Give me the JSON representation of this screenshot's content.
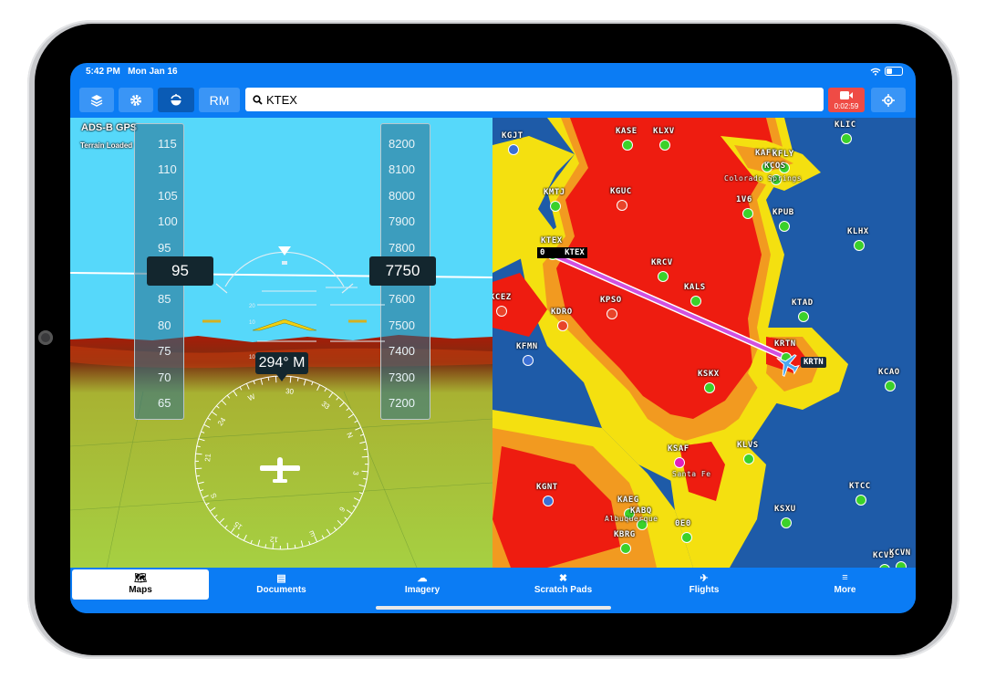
{
  "status_bar": {
    "time": "5:42 PM",
    "date": "Mon Jan 16",
    "wifi_icon": "wifi-icon",
    "battery_level": 0.35
  },
  "toolbar": {
    "layers_icon": "layers-icon",
    "settings_icon": "gear-icon",
    "view_icon": "synthetic-vision-icon",
    "rm_label": "RM",
    "search_icon": "search-icon",
    "search_value": "KTEX",
    "record_icon": "video-camera-icon",
    "record_time": "0:02:59",
    "locate_icon": "crosshair-icon"
  },
  "synthetic_vision": {
    "source_label": "ADS-B GPS",
    "terrain_label": "Terrain Loaded",
    "airspeed_ticks": [
      "115",
      "110",
      "105",
      "100",
      "95",
      "90",
      "85",
      "80",
      "75",
      "70",
      "65"
    ],
    "airspeed_value": "95",
    "altitude_ticks": [
      "8200",
      "8100",
      "8000",
      "7900",
      "7800",
      "7700",
      "7600",
      "7500",
      "7400",
      "7300",
      "7200"
    ],
    "altitude_value": "7750",
    "heading_value": "294° M",
    "pitch_labels": [
      "20",
      "10",
      "10",
      "20"
    ],
    "compass_labels": [
      "W",
      "30",
      "33",
      "N",
      "3",
      "6",
      "E",
      "12",
      "15",
      "S",
      "21",
      "24"
    ]
  },
  "map": {
    "route": {
      "from": "KTEX",
      "to": "KRTN",
      "from_tag": "0"
    },
    "airports": [
      {
        "id": "KGJT",
        "color": "#3b6fd4"
      },
      {
        "id": "KASE",
        "color": "#3bd12a"
      },
      {
        "id": "KLXV",
        "color": "#3bd12a"
      },
      {
        "id": "KLIC",
        "color": "#3bd12a"
      },
      {
        "id": "KAFF",
        "color": "#3bd12a"
      },
      {
        "id": "KFLY",
        "color": "#3bd12a"
      },
      {
        "id": "KCOS",
        "color": "#3bd12a"
      },
      {
        "id": "KMTJ",
        "color": "#3bd12a"
      },
      {
        "id": "KGUC",
        "color": "#e8442a"
      },
      {
        "id": "1V6",
        "color": "#3bd12a"
      },
      {
        "id": "KPUB",
        "color": "#3bd12a"
      },
      {
        "id": "KLHX",
        "color": "#3bd12a"
      },
      {
        "id": "KTEX",
        "color": "#3bd12a"
      },
      {
        "id": "KRCV",
        "color": "#3bd12a"
      },
      {
        "id": "KALS",
        "color": "#3bd12a"
      },
      {
        "id": "KCEZ",
        "color": "#e8442a"
      },
      {
        "id": "KDRO",
        "color": "#e8442a"
      },
      {
        "id": "KPSO",
        "color": "#e8442a"
      },
      {
        "id": "KTAD",
        "color": "#3bd12a"
      },
      {
        "id": "KFMN",
        "color": "#3b6fd4"
      },
      {
        "id": "KRTN",
        "color": "#3bd12a"
      },
      {
        "id": "KSKX",
        "color": "#3bd12a"
      },
      {
        "id": "KCAO",
        "color": "#3bd12a"
      },
      {
        "id": "KSAF",
        "color": "#e020c0"
      },
      {
        "id": "KLVS",
        "color": "#3bd12a"
      },
      {
        "id": "KGNT",
        "color": "#3b6fd4"
      },
      {
        "id": "KAEG",
        "color": "#3bd12a"
      },
      {
        "id": "KABQ",
        "color": "#3bd12a"
      },
      {
        "id": "0E0",
        "color": "#3bd12a"
      },
      {
        "id": "KTCC",
        "color": "#3bd12a"
      },
      {
        "id": "KSXU",
        "color": "#3bd12a"
      },
      {
        "id": "KBRG",
        "color": "#3bd12a"
      },
      {
        "id": "KCVS",
        "color": "#3bd12a"
      },
      {
        "id": "KCVN",
        "color": "#3bd12a"
      }
    ],
    "city_labels": [
      "Colorado Springs",
      "Albuquerque",
      "Santa Fe"
    ]
  },
  "tabs": [
    {
      "label": "Maps",
      "icon": "map-icon",
      "selected": true
    },
    {
      "label": "Documents",
      "icon": "book-icon",
      "selected": false
    },
    {
      "label": "Imagery",
      "icon": "cloud-sun-icon",
      "selected": false
    },
    {
      "label": "Scratch Pads",
      "icon": "pencil-cross-icon",
      "selected": false
    },
    {
      "label": "Flights",
      "icon": "airplane-takeoff-icon",
      "selected": false
    },
    {
      "label": "More",
      "icon": "menu-icon",
      "selected": false
    }
  ]
}
